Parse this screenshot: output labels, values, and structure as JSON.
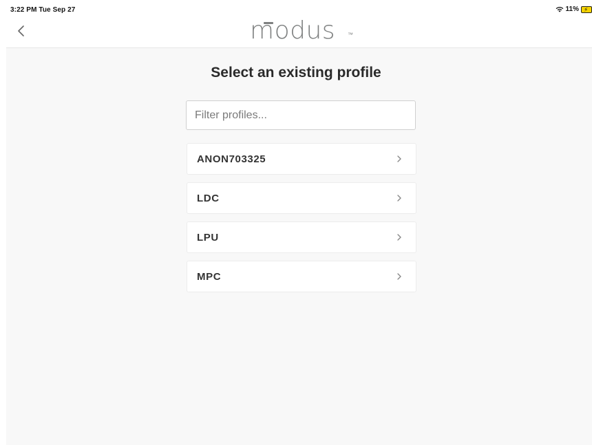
{
  "status_bar": {
    "time": "3:22 PM  Tue Sep 27",
    "battery_percent": "11%",
    "icons": [
      "wifi-icon",
      "battery-charging-icon"
    ]
  },
  "nav": {
    "back_icon": "chevron-left-icon",
    "logo_text": "modus",
    "logo_trademark": "™"
  },
  "main": {
    "title": "Select an existing profile",
    "filter": {
      "placeholder": "Filter profiles...",
      "value": ""
    },
    "profiles": [
      {
        "label": "ANON703325"
      },
      {
        "label": "LDC"
      },
      {
        "label": "LPU"
      },
      {
        "label": "MPC"
      }
    ],
    "row_icon": "chevron-right-icon"
  },
  "colors": {
    "background": "#f8f8f8",
    "logo": "#7e8080",
    "text": "#333333",
    "battery": "#f5d300"
  }
}
